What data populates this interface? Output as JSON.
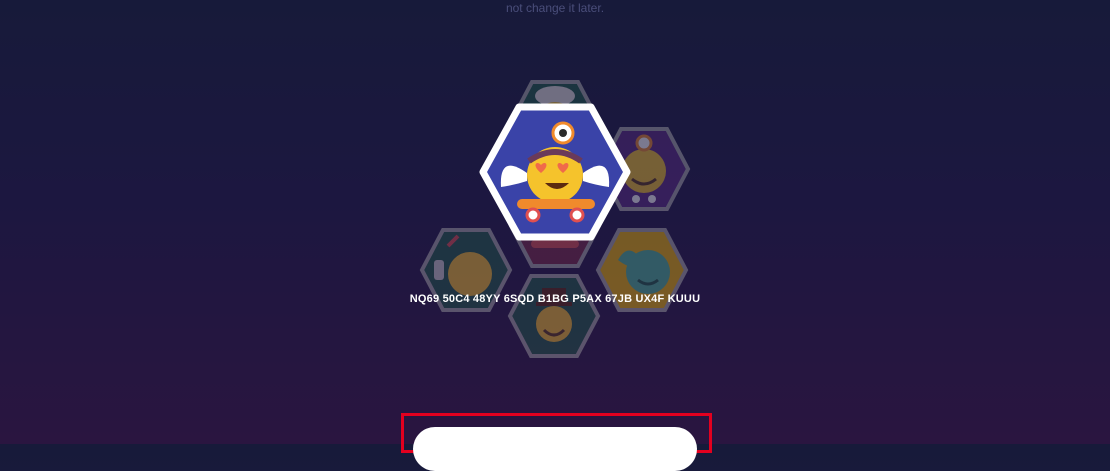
{
  "header": {
    "hint_text": "not change it later."
  },
  "avatar_picker": {
    "selected_avatar_icon": "winged-skateboard-emoji-icon",
    "background_avatar_icons": [
      "chef-hat-emoji-icon",
      "doctor-emoji-icon",
      "headphones-emoji-icon",
      "skateboard-emoji-icon",
      "crowned-emoji-icon",
      "top-hat-emoji-icon"
    ],
    "colors": {
      "selected_hex_fill": "#3a43a8",
      "selected_hex_border": "#ffffff",
      "emoji_yellow": "#f5c32c"
    }
  },
  "account": {
    "id_code": "NQ69 50C4 48YY 6SQD B1BG P5AX 67JB UX4F KUUU"
  },
  "colors": {
    "highlight_border": "#e3001f",
    "button_bg": "#ffffff"
  }
}
